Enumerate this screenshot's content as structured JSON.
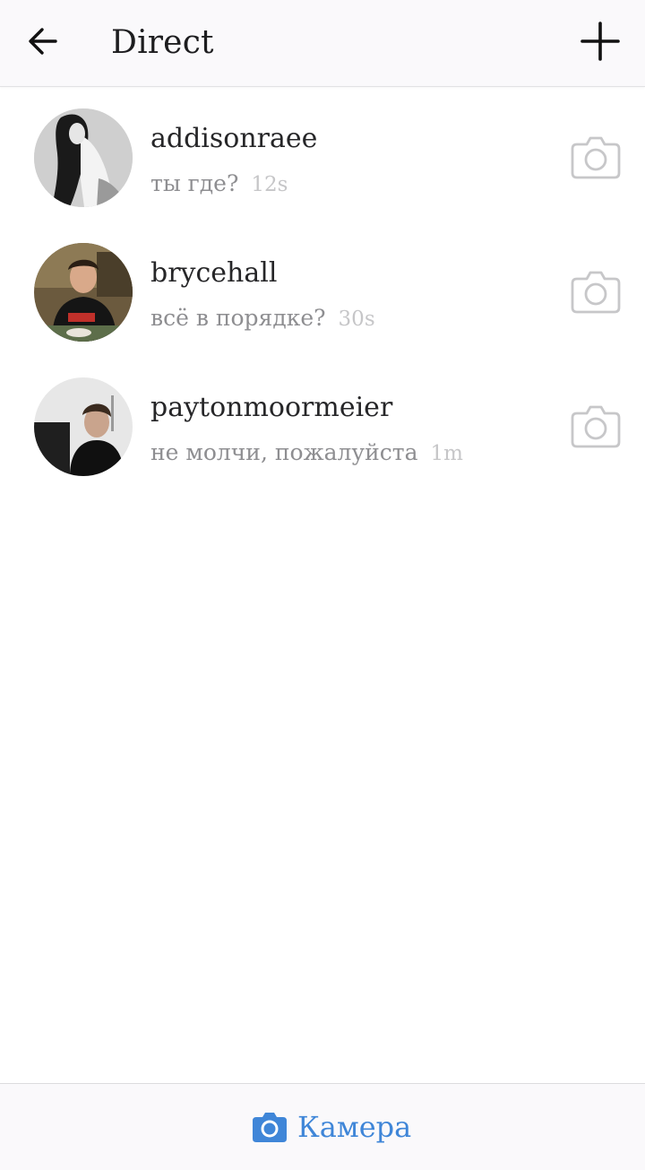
{
  "header": {
    "title": "Direct",
    "back_icon": "arrow-left-icon",
    "add_icon": "plus-icon"
  },
  "threads": [
    {
      "username": "addisonraee",
      "message": "ты где?",
      "time": "12s"
    },
    {
      "username": "brycehall",
      "message": "всё в порядке?",
      "time": "30s"
    },
    {
      "username": "paytonmoormeier",
      "message": "не молчи, пожалуйста",
      "time": "1m"
    }
  ],
  "footer": {
    "camera_label": "Камера",
    "camera_icon": "camera-icon"
  },
  "colors": {
    "accent": "#3f86d8",
    "text_primary": "#262628",
    "text_secondary": "#8e8e91",
    "text_time": "#c6c6c8",
    "bar_background": "#faf9fb"
  }
}
